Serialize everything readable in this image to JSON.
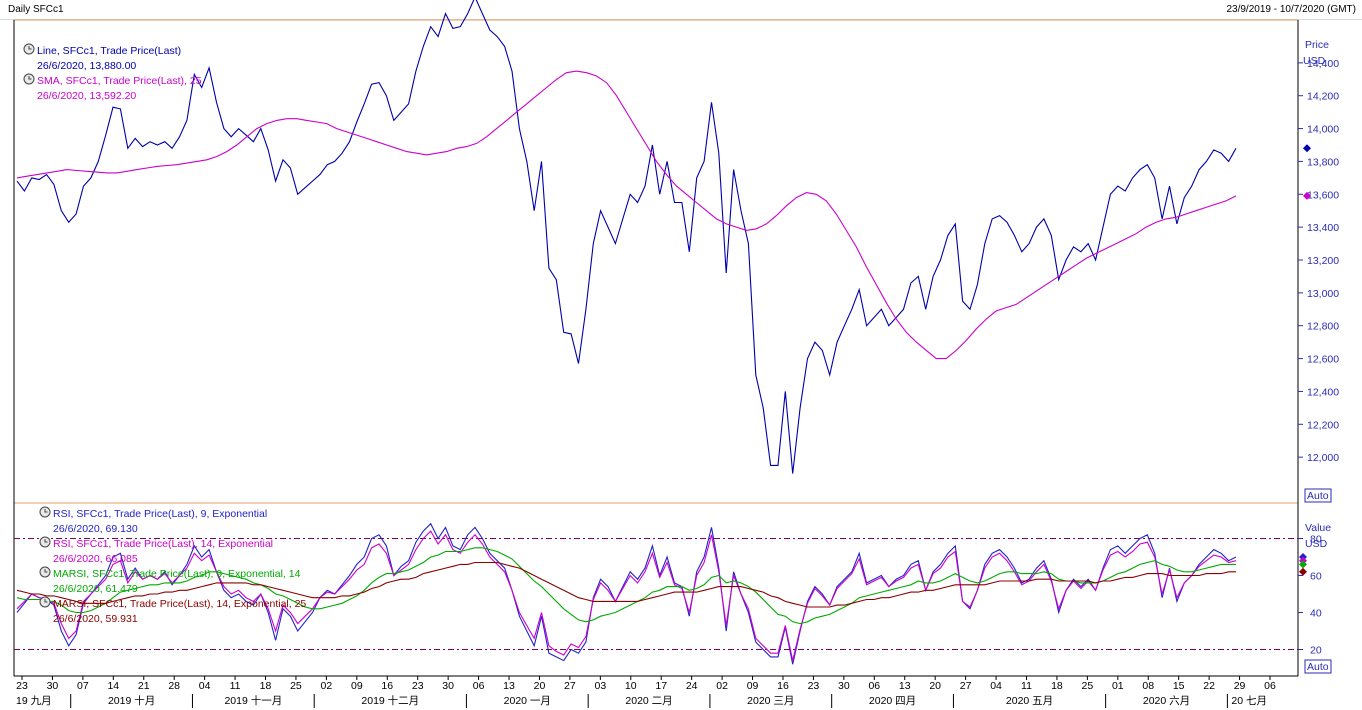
{
  "header": {
    "title": "Daily SFCc1",
    "range": "23/9/2019 - 10/7/2020 (GMT)"
  },
  "price_panel": {
    "unit_label": "Price",
    "currency": "USD",
    "auto_label": "Auto",
    "legend": [
      {
        "name": "Line, SFCc1, Trade Price(Last)",
        "value": "26/6/2020, 13,880.00",
        "color": "#0000aa"
      },
      {
        "name": "SMA, SFCc1, Trade Price(Last), 25",
        "value": "26/6/2020, 13,592.20",
        "color": "#cc00cc"
      }
    ]
  },
  "rsi_panel": {
    "unit_label": "Value",
    "currency": "USD",
    "auto_label": "Auto",
    "legend": [
      {
        "name": "RSI, SFCc1, Trade Price(Last), 9, Exponential",
        "value": "26/6/2020, 69.130",
        "color": "#2222cc"
      },
      {
        "name": "RSI, SFCc1, Trade Price(Last), 14, Exponential",
        "value": "26/6/2020, 66.085",
        "color": "#cc00cc"
      },
      {
        "name": "MARSI, SFCc1, Trade Price(Last), 9, Exponential, 14",
        "value": "26/6/2020, 61.479",
        "color": "#00aa00"
      },
      {
        "name": "MARSI, SFCc1, Trade Price(Last), 14, Exponential, 25",
        "value": "26/6/2020, 59.931",
        "color": "#8b0000"
      }
    ]
  },
  "x_axis": {
    "day_ticks": [
      "23",
      "30",
      "07",
      "14",
      "21",
      "28",
      "04",
      "11",
      "18",
      "25",
      "02",
      "09",
      "16",
      "23",
      "30",
      "06",
      "13",
      "20",
      "27",
      "03",
      "10",
      "17",
      "24",
      "02",
      "09",
      "16",
      "23",
      "30",
      "06",
      "13",
      "20",
      "27",
      "04",
      "11",
      "18",
      "25",
      "01",
      "08",
      "15",
      "22",
      "29",
      "06"
    ],
    "month_labels": [
      "19 九月",
      "2019 十月",
      "2019 十一月",
      "2019 十二月",
      "2020 一月",
      "2020 二月",
      "2020 三月",
      "2020 四月",
      "2020 五月",
      "2020 六月",
      "20 七月"
    ]
  },
  "chart_data": [
    {
      "type": "line",
      "ylim": [
        11800,
        14600
      ],
      "y_ticks": [
        "14,400",
        "14,200",
        "14,000",
        "13,800",
        "13,600",
        "13,400",
        "13,200",
        "13,000",
        "12,800",
        "12,600",
        "12,400",
        "12,200",
        "12,000"
      ],
      "series": [
        {
          "name": "Line, SFCc1, Trade Price(Last)",
          "color": "#0000aa",
          "values": [
            13680,
            13620,
            13700,
            13690,
            13720,
            13660,
            13500,
            13430,
            13480,
            13650,
            13700,
            13800,
            13960,
            14130,
            14120,
            13880,
            13940,
            13890,
            13920,
            13900,
            13920,
            13880,
            13950,
            14050,
            14330,
            14250,
            14370,
            14160,
            14000,
            13950,
            14000,
            13960,
            13920,
            14000,
            13870,
            13680,
            13810,
            13760,
            13600,
            13640,
            13680,
            13720,
            13780,
            13800,
            13850,
            13920,
            14040,
            14150,
            14270,
            14280,
            14200,
            14050,
            14100,
            14150,
            14350,
            14500,
            14620,
            14560,
            14700,
            14610,
            14620,
            14700,
            14800,
            14700,
            14600,
            14560,
            14500,
            14350,
            14000,
            13800,
            13500,
            13800,
            13150,
            13080,
            12760,
            12750,
            12570,
            12900,
            13300,
            13500,
            13400,
            13300,
            13450,
            13600,
            13550,
            13650,
            13900,
            13600,
            13800,
            13550,
            13550,
            13250,
            13700,
            13800,
            14160,
            13850,
            13120,
            13750,
            13500,
            13300,
            12500,
            12300,
            11950,
            11950,
            12400,
            11900,
            12300,
            12600,
            12700,
            12650,
            12500,
            12700,
            12800,
            12900,
            13020,
            12800,
            12850,
            12900,
            12800,
            12850,
            12900,
            13060,
            13100,
            12900,
            13100,
            13200,
            13350,
            13420,
            12950,
            12900,
            13050,
            13300,
            13450,
            13470,
            13430,
            13350,
            13250,
            13300,
            13400,
            13450,
            13350,
            13080,
            13200,
            13280,
            13250,
            13300,
            13200,
            13400,
            13600,
            13650,
            13620,
            13700,
            13750,
            13780,
            13700,
            13450,
            13650,
            13420,
            13580,
            13650,
            13750,
            13800,
            13870,
            13850,
            13800,
            13880
          ]
        },
        {
          "name": "SMA, SFCc1, Trade Price(Last), 25",
          "color": "#cc00cc",
          "values": [
            13700,
            13710,
            13720,
            13730,
            13740,
            13750,
            13745,
            13740,
            13735,
            13730,
            13730,
            13740,
            13750,
            13760,
            13770,
            13775,
            13780,
            13790,
            13800,
            13810,
            13830,
            13860,
            13900,
            13950,
            14000,
            14030,
            14050,
            14060,
            14060,
            14050,
            14040,
            14030,
            14000,
            13980,
            13960,
            13940,
            13920,
            13900,
            13880,
            13860,
            13850,
            13840,
            13850,
            13860,
            13880,
            13890,
            13910,
            13950,
            14000,
            14050,
            14100,
            14150,
            14200,
            14250,
            14300,
            14340,
            14350,
            14340,
            14320,
            14280,
            14200,
            14100,
            14000,
            13900,
            13800,
            13720,
            13650,
            13600,
            13550,
            13500,
            13450,
            13420,
            13400,
            13380,
            13390,
            13420,
            13470,
            13530,
            13580,
            13610,
            13600,
            13560,
            13480,
            13380,
            13280,
            13160,
            13050,
            12940,
            12840,
            12760,
            12700,
            12650,
            12600,
            12600,
            12650,
            12710,
            12780,
            12840,
            12890,
            12910,
            12930,
            12970,
            13010,
            13050,
            13090,
            13130,
            13170,
            13210,
            13240,
            13270,
            13300,
            13330,
            13360,
            13400,
            13430,
            13450,
            13460,
            13480,
            13500,
            13520,
            13540,
            13560,
            13590
          ]
        }
      ]
    },
    {
      "type": "line",
      "ylim": [
        10,
        90
      ],
      "y_ticks": [
        "80",
        "60",
        "40",
        "20"
      ],
      "reference_lines": [
        80,
        20
      ],
      "series": [
        {
          "name": "RSI, SFCc1, Trade Price(Last), 9, Exponential",
          "color": "#2222cc",
          "values": [
            40,
            45,
            50,
            48,
            47,
            44,
            30,
            22,
            28,
            45,
            50,
            55,
            60,
            70,
            72,
            58,
            64,
            58,
            60,
            58,
            62,
            55,
            60,
            66,
            76,
            70,
            74,
            62,
            52,
            48,
            50,
            46,
            44,
            50,
            40,
            25,
            42,
            38,
            30,
            35,
            40,
            48,
            52,
            50,
            55,
            60,
            66,
            70,
            80,
            82,
            76,
            60,
            65,
            68,
            78,
            84,
            88,
            80,
            86,
            76,
            74,
            82,
            86,
            80,
            72,
            68,
            64,
            52,
            38,
            30,
            22,
            38,
            18,
            16,
            14,
            20,
            18,
            24,
            48,
            58,
            54,
            46,
            54,
            62,
            58,
            64,
            76,
            60,
            70,
            56,
            54,
            38,
            62,
            70,
            86,
            64,
            30,
            62,
            50,
            40,
            24,
            20,
            16,
            16,
            32,
            12,
            30,
            46,
            54,
            50,
            44,
            54,
            58,
            62,
            72,
            56,
            58,
            60,
            54,
            58,
            60,
            66,
            68,
            52,
            62,
            66,
            72,
            76,
            46,
            42,
            52,
            66,
            72,
            74,
            70,
            64,
            56,
            58,
            64,
            68,
            58,
            40,
            52,
            58,
            54,
            58,
            52,
            64,
            74,
            76,
            72,
            76,
            80,
            82,
            72,
            48,
            64,
            46,
            56,
            60,
            66,
            70,
            74,
            72,
            68,
            70
          ]
        },
        {
          "name": "RSI, SFCc1, Trade Price(Last), 14, Exponential",
          "color": "#cc00cc",
          "values": [
            42,
            46,
            50,
            48,
            47,
            45,
            34,
            26,
            30,
            46,
            50,
            54,
            58,
            66,
            68,
            56,
            62,
            58,
            60,
            58,
            61,
            56,
            60,
            64,
            72,
            68,
            71,
            62,
            54,
            50,
            52,
            48,
            46,
            50,
            42,
            30,
            44,
            40,
            34,
            38,
            42,
            48,
            51,
            50,
            54,
            58,
            63,
            66,
            75,
            77,
            72,
            60,
            63,
            66,
            74,
            80,
            84,
            77,
            82,
            74,
            72,
            78,
            82,
            77,
            70,
            66,
            62,
            52,
            40,
            33,
            26,
            40,
            22,
            19,
            17,
            23,
            21,
            27,
            47,
            56,
            52,
            46,
            53,
            60,
            56,
            62,
            72,
            59,
            67,
            55,
            53,
            40,
            60,
            67,
            82,
            62,
            33,
            60,
            50,
            42,
            26,
            22,
            18,
            18,
            33,
            14,
            31,
            45,
            53,
            49,
            44,
            53,
            57,
            61,
            69,
            55,
            57,
            59,
            54,
            57,
            59,
            64,
            66,
            52,
            61,
            64,
            70,
            73,
            46,
            43,
            52,
            64,
            70,
            72,
            68,
            62,
            55,
            57,
            62,
            66,
            57,
            42,
            52,
            57,
            53,
            57,
            52,
            63,
            71,
            73,
            70,
            73,
            77,
            78,
            70,
            50,
            63,
            48,
            56,
            60,
            65,
            68,
            71,
            70,
            67,
            68
          ]
        },
        {
          "name": "MARSI, SFCc1, Trade Price(Last), 9, Exponential, 14",
          "color": "#00aa00",
          "values": [
            48,
            47,
            47,
            47,
            46,
            46,
            44,
            41,
            40,
            40,
            41,
            43,
            45,
            48,
            51,
            52,
            53,
            54,
            55,
            55,
            56,
            56,
            56,
            57,
            59,
            60,
            62,
            62,
            61,
            60,
            59,
            58,
            56,
            55,
            53,
            50,
            49,
            47,
            45,
            43,
            42,
            42,
            43,
            44,
            45,
            47,
            49,
            52,
            56,
            59,
            61,
            61,
            62,
            63,
            65,
            67,
            70,
            71,
            73,
            73,
            73,
            74,
            75,
            75,
            74,
            73,
            71,
            69,
            65,
            61,
            57,
            54,
            50,
            46,
            42,
            39,
            36,
            35,
            36,
            38,
            39,
            40,
            42,
            44,
            46,
            48,
            51,
            52,
            54,
            54,
            54,
            52,
            53,
            55,
            59,
            60,
            56,
            57,
            56,
            54,
            51,
            47,
            43,
            39,
            38,
            35,
            34,
            35,
            37,
            38,
            39,
            41,
            43,
            45,
            48,
            49,
            50,
            51,
            52,
            53,
            54,
            55,
            57,
            56,
            56,
            57,
            59,
            61,
            59,
            57,
            56,
            57,
            59,
            61,
            62,
            62,
            61,
            61,
            61,
            62,
            61,
            58,
            57,
            57,
            56,
            56,
            56,
            57,
            59,
            61,
            62,
            64,
            66,
            67,
            68,
            66,
            65,
            63,
            62,
            62,
            63,
            64,
            65,
            66,
            66,
            66
          ]
        },
        {
          "name": "MARSI, SFCc1, Trade Price(Last), 14, Exponential, 25",
          "color": "#8b0000",
          "values": [
            52,
            51,
            50,
            50,
            49,
            49,
            48,
            47,
            46,
            45,
            45,
            45,
            45,
            46,
            47,
            48,
            49,
            49,
            50,
            50,
            51,
            51,
            52,
            52,
            53,
            54,
            55,
            56,
            56,
            56,
            56,
            56,
            55,
            55,
            54,
            53,
            52,
            51,
            50,
            49,
            48,
            48,
            48,
            48,
            49,
            49,
            50,
            51,
            53,
            54,
            56,
            57,
            58,
            58,
            59,
            61,
            62,
            63,
            64,
            65,
            66,
            66,
            67,
            67,
            67,
            67,
            66,
            65,
            64,
            62,
            60,
            58,
            56,
            54,
            52,
            50,
            48,
            47,
            46,
            46,
            46,
            46,
            46,
            46,
            46,
            47,
            48,
            49,
            50,
            51,
            51,
            51,
            51,
            52,
            53,
            54,
            54,
            54,
            54,
            53,
            52,
            51,
            49,
            48,
            46,
            45,
            44,
            43,
            43,
            43,
            43,
            44,
            44,
            45,
            46,
            47,
            47,
            48,
            48,
            49,
            50,
            51,
            51,
            52,
            52,
            53,
            54,
            55,
            55,
            55,
            55,
            55,
            56,
            57,
            57,
            57,
            57,
            57,
            58,
            58,
            58,
            57,
            57,
            57,
            57,
            57,
            56,
            57,
            57,
            58,
            59,
            59,
            60,
            61,
            61,
            61,
            60,
            60,
            60,
            60,
            60,
            61,
            61,
            61,
            62,
            62
          ]
        }
      ]
    }
  ]
}
